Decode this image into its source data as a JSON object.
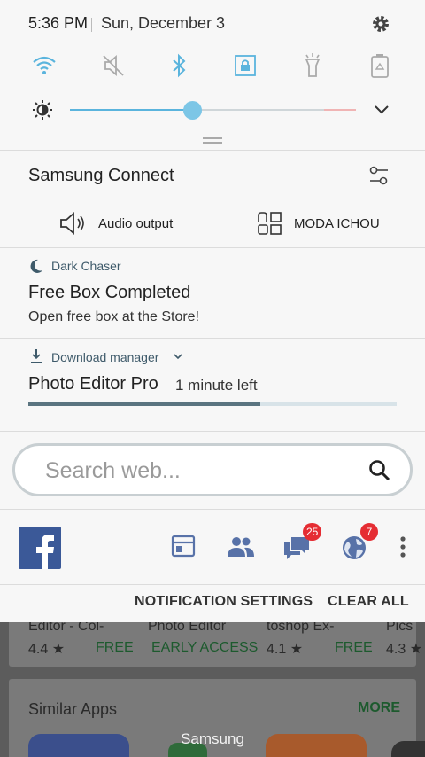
{
  "status": {
    "time": "5:36 PM",
    "date": "Sun, December 3"
  },
  "quick_settings": [
    {
      "icon": "wifi-icon",
      "active": true
    },
    {
      "icon": "mute-icon",
      "active": false
    },
    {
      "icon": "bluetooth-icon",
      "active": true
    },
    {
      "icon": "screen-lock-icon",
      "active": true
    },
    {
      "icon": "flashlight-icon",
      "active": false
    },
    {
      "icon": "battery-saver-icon",
      "active": false
    }
  ],
  "brightness": {
    "level": 0.47
  },
  "samsung_connect": {
    "title": "Samsung Connect",
    "audio_output": "Audio output",
    "device": "MODA ICHOU"
  },
  "notifications": {
    "dark_chaser": {
      "app": "Dark Chaser",
      "title": "Free Box Completed",
      "body": "Open free box at the Store!"
    },
    "download": {
      "app": "Download manager",
      "title": "Photo Editor Pro",
      "status": "1 minute left",
      "progress": 0.63
    }
  },
  "search": {
    "placeholder": "Search web..."
  },
  "facebook": {
    "badges": {
      "messages": "25",
      "notifications": "7"
    }
  },
  "actions": {
    "settings": "NOTIFICATION SETTINGS",
    "clear_all": "CLEAR ALL"
  },
  "background_app": {
    "apps": [
      {
        "name": "Editor - Col-",
        "rating": "4.4 ★",
        "price": "FREE"
      },
      {
        "name": "Photo Editor",
        "price": "EARLY ACCESS"
      },
      {
        "name": "toshop Ex-",
        "rating": "4.1 ★",
        "price": "FREE"
      },
      {
        "name": "Pics",
        "rating": "4.3 ★"
      }
    ],
    "similar_title": "Similar Apps",
    "more_label": "MORE"
  },
  "toast": "Samsung",
  "colors": {
    "accent": "#5ab4dd",
    "facebook": "#3b5998",
    "badge": "#e52d33"
  }
}
